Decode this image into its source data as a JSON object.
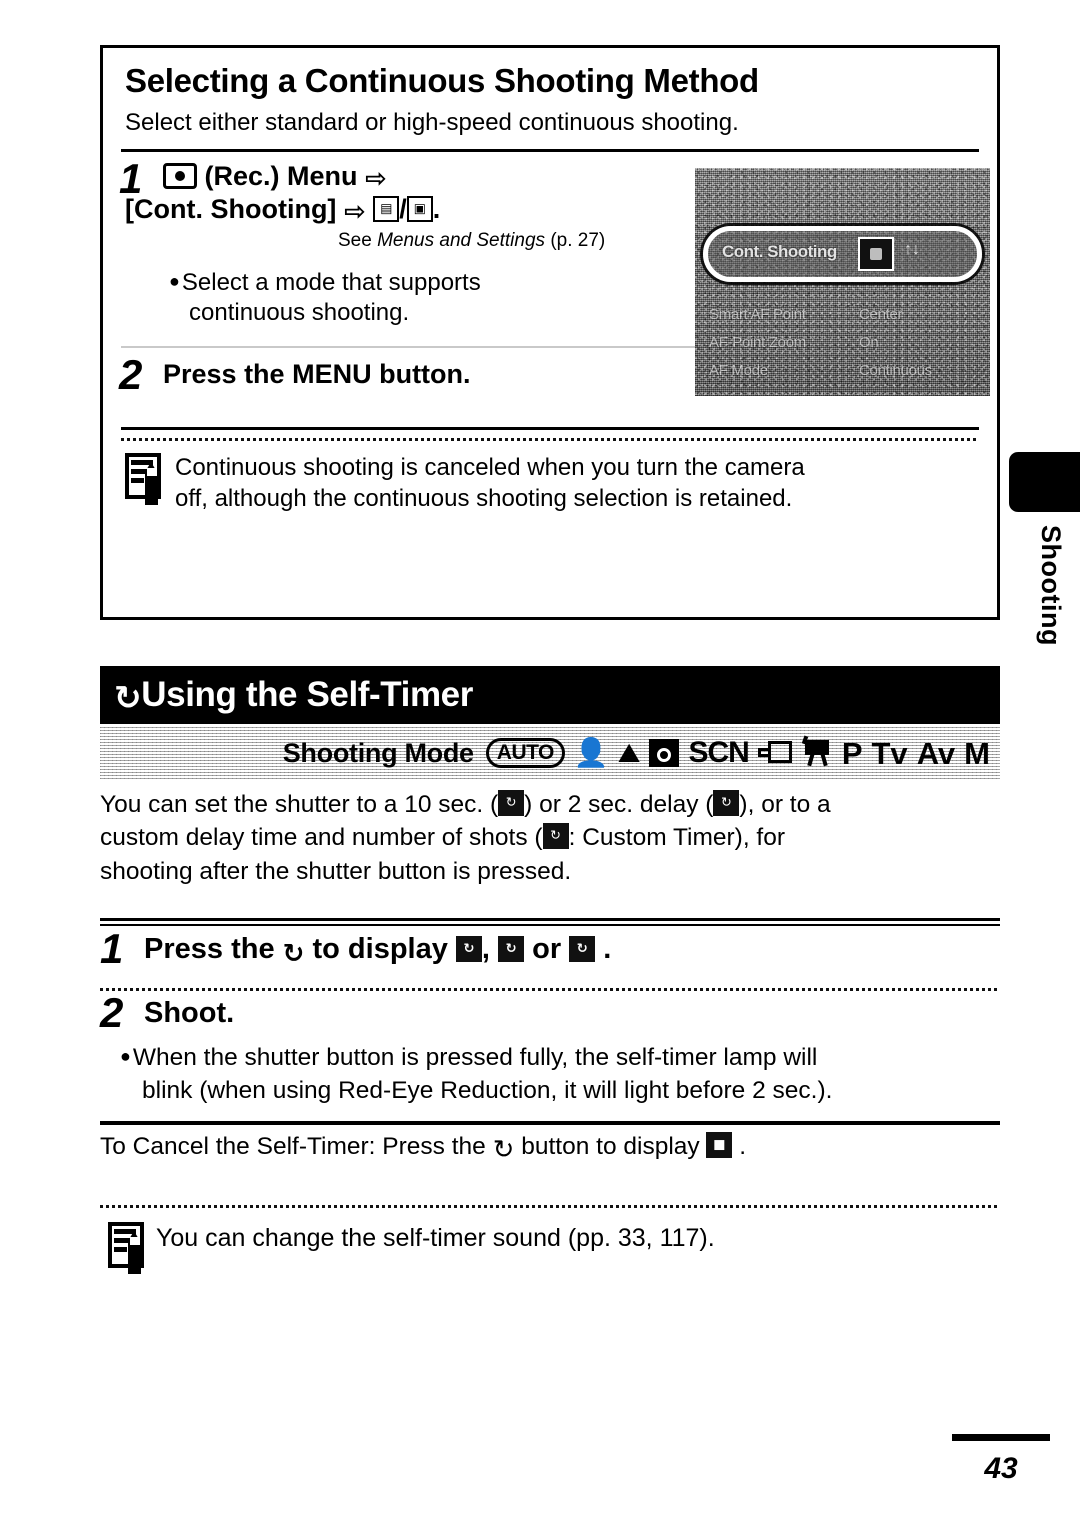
{
  "page": {
    "number": "43",
    "side_tab_label": "Shooting"
  },
  "section1": {
    "title": "Selecting a Continuous Shooting Method",
    "subtitle": "Select either standard or high-speed continuous shooting.",
    "step1": {
      "number": "1",
      "line1_icon": "rec-menu-icon",
      "line1_text": "(Rec.) Menu",
      "arrow": "⇨",
      "line2_text": "[Cont. Shooting]",
      "icon_a": "continuous-shooting-icon",
      "icon_b": "high-speed-continuous-icon",
      "period": ".",
      "see_ref_prefix": "See ",
      "see_ref_italic": "Menus and Settings",
      "see_ref_suffix": " (p. 27)",
      "bullet": "Select a mode that supports",
      "bullet_cont": "continuous shooting."
    },
    "step2": {
      "number": "2",
      "text_before": "Press the ",
      "text_bold": "MENU",
      "text_after": " button."
    },
    "note": {
      "icon": "memo-note-icon",
      "line1": "Continuous shooting is canceled when you turn the camera",
      "line2": "off, although the continuous shooting selection is retained."
    },
    "menu_photo": {
      "highlight_label": "Cont. Shooting",
      "highlight_alt": "↑↓",
      "rows": [
        {
          "label": "Smart AF Point",
          "value": "Center"
        },
        {
          "label": "AF-Point Zoom",
          "value": "On"
        },
        {
          "label": "AF Mode",
          "value": "Continuous"
        }
      ]
    }
  },
  "section2": {
    "header_icon": "self-timer-icon",
    "header_title": "Using the Self-Timer",
    "shooting_mode": {
      "label": "Shooting Mode",
      "modes": [
        {
          "name": "auto-mode-icon",
          "label": "AUTO"
        },
        {
          "name": "portrait-mode-icon",
          "label": ""
        },
        {
          "name": "landscape-mode-icon",
          "label": ""
        },
        {
          "name": "night-scene-mode-icon",
          "label": ""
        },
        {
          "name": "scn-mode-label",
          "label": "SCN"
        },
        {
          "name": "stitch-assist-mode-icon",
          "label": ""
        },
        {
          "name": "movie-mode-icon",
          "label": ""
        },
        {
          "name": "program-mode-label",
          "label": "P"
        },
        {
          "name": "tv-mode-label",
          "label": "Tv"
        },
        {
          "name": "av-mode-label",
          "label": "Av"
        },
        {
          "name": "manual-mode-label",
          "label": "M"
        }
      ]
    },
    "intro": {
      "p1": "You can set the shutter to a 10 sec. (",
      "p2": ") or 2 sec. delay (",
      "p3": "), or to a",
      "p4": "custom delay time and number of shots (",
      "p5": ": Custom Timer), for",
      "p6": "shooting after the shutter button is pressed."
    },
    "step1": {
      "number": "1",
      "text_before": "Press the ",
      "timer_glyph": "↻",
      "text_mid": " to display ",
      "icon1": "timer-10sec-icon",
      "comma": ", ",
      "icon2": "timer-2sec-icon",
      "text_or": " or ",
      "icon3": "custom-timer-icon",
      "text_end": " ."
    },
    "step2": {
      "number": "2",
      "text": "Shoot."
    },
    "bullet": {
      "line1": "When the shutter button is pressed fully, the self-timer lamp will",
      "line2": "blink (when using Red-Eye Reduction, it will light before 2 sec.)."
    },
    "cancel": {
      "text_before": "To Cancel the Self-Timer: Press the ",
      "text_mid": " button to display ",
      "icon": "self-timer-off-icon",
      "text_end": " ."
    },
    "note": {
      "icon": "memo-note-icon",
      "text": "You can change the self-timer sound (pp. 33, 117)."
    }
  },
  "colors": {
    "ink": "#000000",
    "paper": "#ffffff",
    "rule_light": "#c9c9c9"
  }
}
